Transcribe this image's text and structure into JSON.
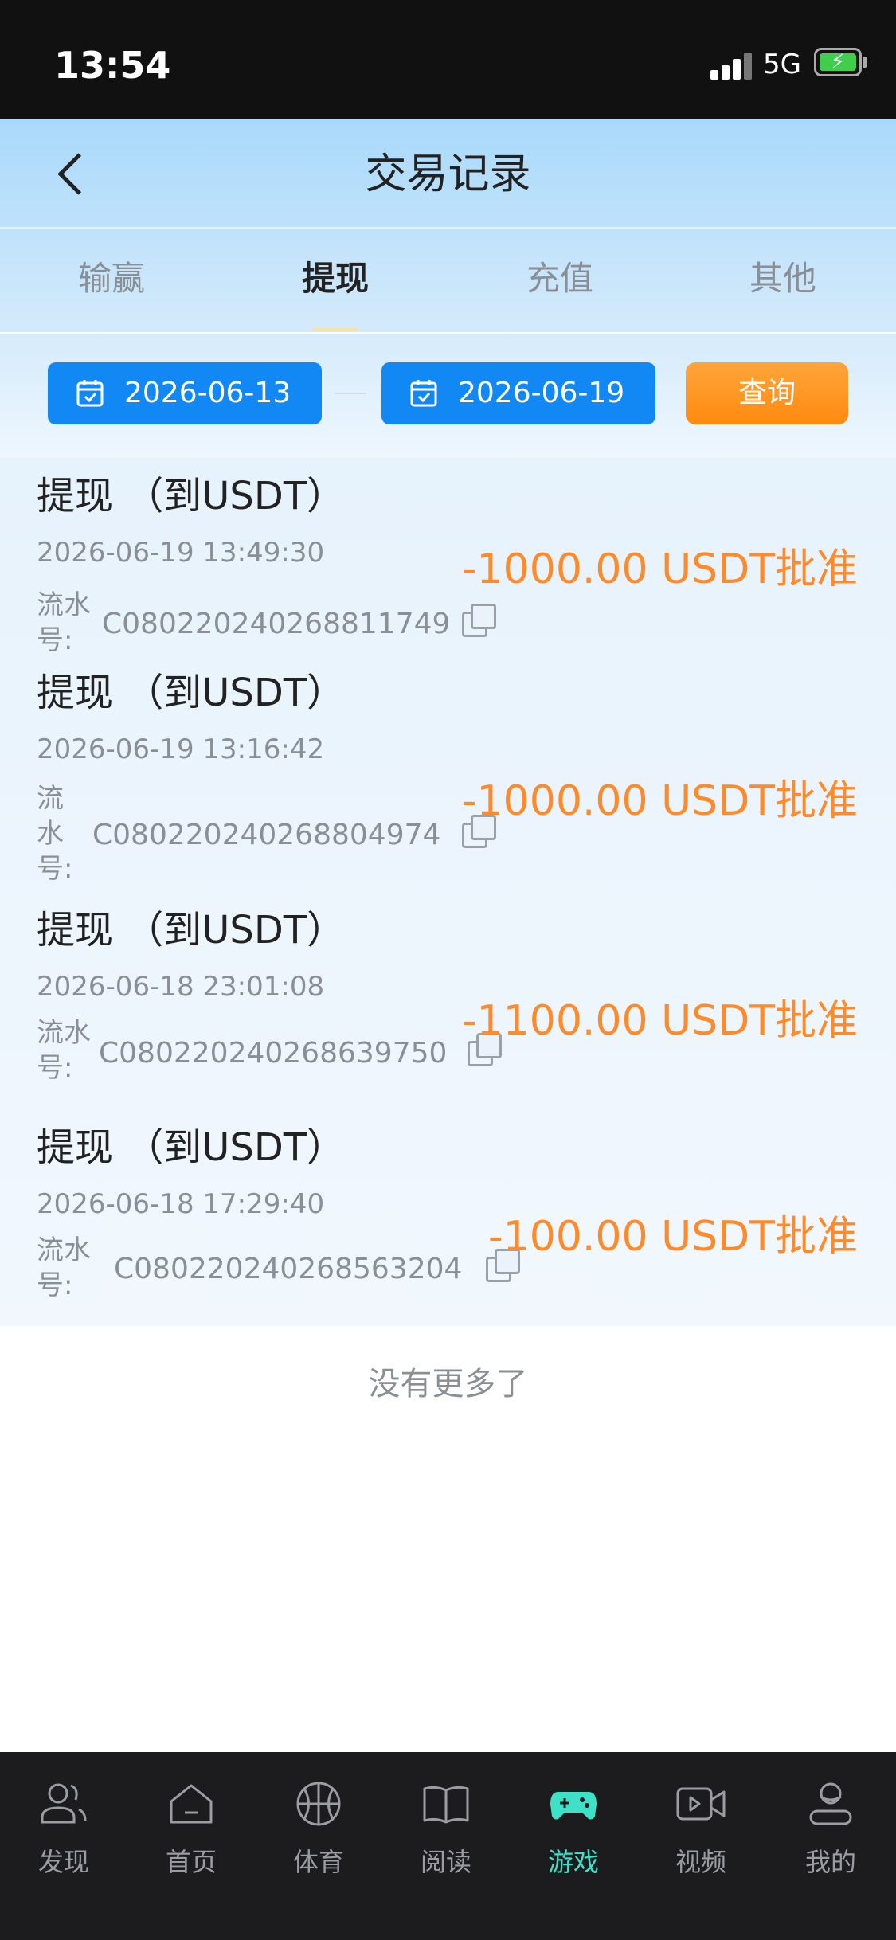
{
  "status_bar": {
    "time": "13:54",
    "network": "5G"
  },
  "header": {
    "title": "交易记录"
  },
  "tabs": [
    {
      "label": "输赢"
    },
    {
      "label": "提现"
    },
    {
      "label": "充值"
    },
    {
      "label": "其他"
    }
  ],
  "active_tab": "提现",
  "filter": {
    "start_date": "2026-06-13",
    "end_date": "2026-06-19",
    "query_label": "查询"
  },
  "records": [
    {
      "title": "提现 （到USDT）",
      "time": "2026-06-19 13:49:30",
      "serial_label": "流水号:",
      "serial": "C08022024026881174​9",
      "amount": "-1000.00 USDT批准"
    },
    {
      "title": "提现 （到USDT）",
      "time": "2026-06-19 13:16:42",
      "serial_label": "流水号:",
      "serial": "C080220240268804974",
      "amount": "-1000.00 USDT批准"
    },
    {
      "title": "提现 （到USDT）",
      "time": "2026-06-18 23:01:08",
      "serial_label": "流水号:",
      "serial": "C080220240268639750",
      "amount": "-1100.00 USDT批准"
    },
    {
      "title": "提现 （到USDT）",
      "time": "2026-06-18 17:29:40",
      "serial_label": "流水号:",
      "serial": "C080220240268563204",
      "amount": "-100.00 USDT批准"
    }
  ],
  "footer_text": "没有更多了",
  "bottom_nav": [
    {
      "label": "发现",
      "icon": "users-icon"
    },
    {
      "label": "首页",
      "icon": "home-icon"
    },
    {
      "label": "体育",
      "icon": "basketball-icon"
    },
    {
      "label": "阅读",
      "icon": "book-icon"
    },
    {
      "label": "游戏",
      "icon": "gamepad-icon"
    },
    {
      "label": "视频",
      "icon": "video-icon"
    },
    {
      "label": "我的",
      "icon": "profile-icon"
    }
  ],
  "colors": {
    "accent_blue": "#1188f4",
    "accent_orange": "#ff8a2a",
    "active_nav": "#3ee1c8"
  }
}
